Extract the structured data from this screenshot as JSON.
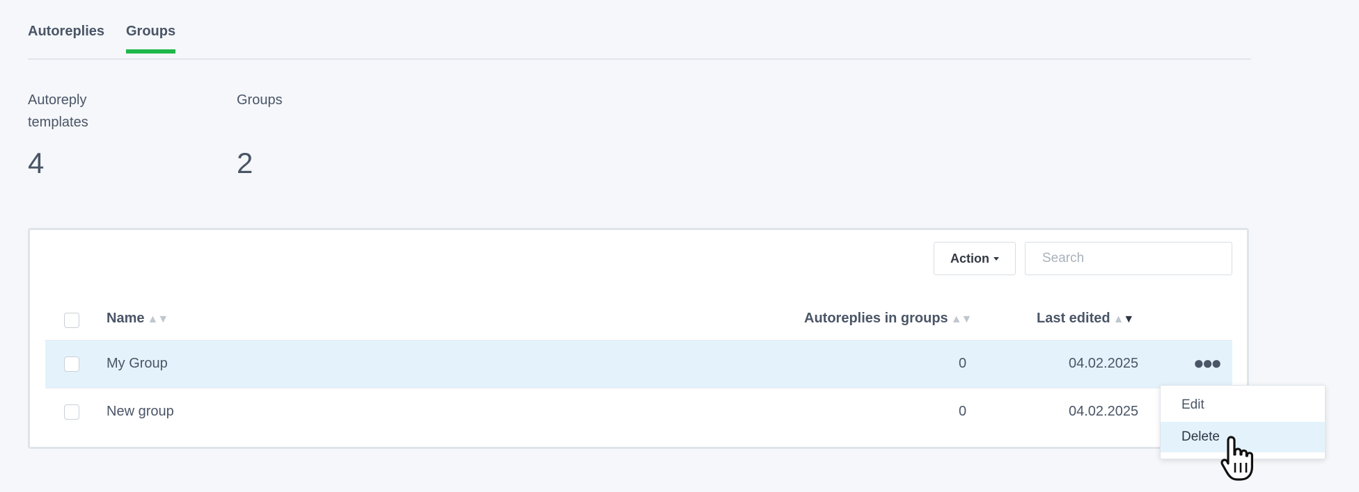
{
  "tabs": [
    {
      "label": "Autoreplies",
      "active": false
    },
    {
      "label": "Groups",
      "active": true
    }
  ],
  "stats": [
    {
      "label": "Autoreply templates",
      "value": "4"
    },
    {
      "label": "Groups",
      "value": "2"
    }
  ],
  "toolbar": {
    "action_label": "Action",
    "search_placeholder": "Search"
  },
  "table": {
    "columns": [
      "Name",
      "Autoreplies in groups",
      "Last edited"
    ],
    "rows": [
      {
        "name": "My Group",
        "autoreplies": "0",
        "last_edited": "04.02.2025",
        "highlighted": true
      },
      {
        "name": "New group",
        "autoreplies": "0",
        "last_edited": "04.02.2025",
        "highlighted": false
      }
    ]
  },
  "row_menu": {
    "items": [
      "Edit",
      "Delete"
    ],
    "hovered": "Delete"
  },
  "icons": {
    "row_actions": "more-horizontal-icon",
    "sort": "sort-arrows-icon",
    "cursor": "hand-pointer-icon"
  },
  "colors": {
    "accent": "#20b84a",
    "row_highlight": "#e4f3fb"
  }
}
